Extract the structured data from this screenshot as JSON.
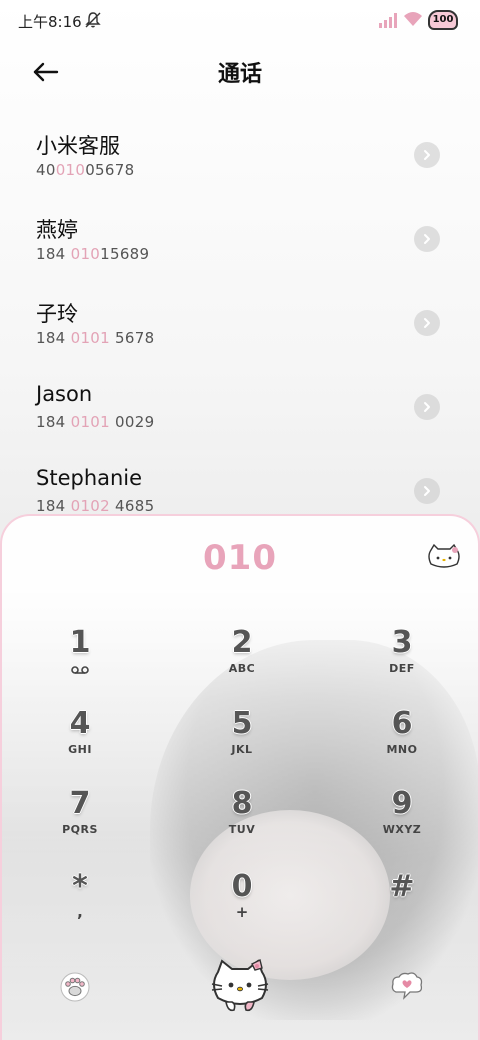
{
  "status_bar": {
    "time": "上午8:16",
    "battery": "100"
  },
  "header": {
    "title": "通话"
  },
  "contacts": [
    {
      "name": "小米客服",
      "number_pre": "40",
      "number_hl": "010",
      "number_post": "05678"
    },
    {
      "name": "燕婷",
      "number_pre": "184 ",
      "number_hl": "010",
      "number_post": "15689"
    },
    {
      "name": "子玲",
      "number_pre": "184 ",
      "number_hl": "0101",
      "number_post": " 5678"
    },
    {
      "name": "Jason",
      "number_pre": "184 ",
      "number_hl": "0101",
      "number_post": " 0029"
    },
    {
      "name": "Stephanie",
      "number_pre": "184 ",
      "number_hl": "0102",
      "number_post": " 4685"
    }
  ],
  "dialer": {
    "number": "010",
    "keys": [
      {
        "digit": "1",
        "sub": "voicemail-icon"
      },
      {
        "digit": "2",
        "sub": "ABC"
      },
      {
        "digit": "3",
        "sub": "DEF"
      },
      {
        "digit": "4",
        "sub": "GHI"
      },
      {
        "digit": "5",
        "sub": "JKL"
      },
      {
        "digit": "6",
        "sub": "MNO"
      },
      {
        "digit": "7",
        "sub": "PQRS"
      },
      {
        "digit": "8",
        "sub": "TUV"
      },
      {
        "digit": "9",
        "sub": "WXYZ"
      },
      {
        "digit": "*",
        "sub": ","
      },
      {
        "digit": "0",
        "sub": "+"
      },
      {
        "digit": "#",
        "sub": ""
      }
    ]
  },
  "colors": {
    "accent_pink": "#e8a4ba",
    "highlight_pink": "#e3a3b6",
    "panel_border": "#f6cfdc"
  },
  "icons": {
    "back": "back-arrow-icon",
    "chevron": "chevron-right-icon",
    "cat": "hello-kitty-icon",
    "paw": "paw-icon",
    "message": "message-cloud-icon"
  }
}
